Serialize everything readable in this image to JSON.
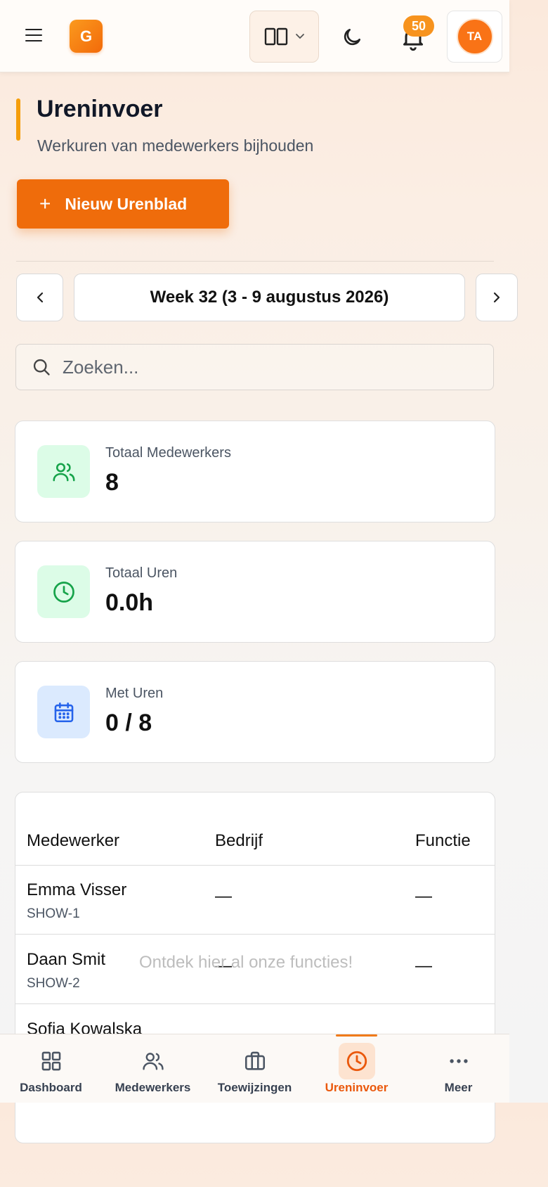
{
  "header": {
    "logo_letter": "G",
    "notification_count": "50",
    "avatar_initials": "TA",
    "icons": [
      "menu-icon",
      "layout-columns-icon",
      "chevron-down-icon",
      "moon-icon",
      "bell-icon"
    ]
  },
  "page": {
    "title": "Ureninvoer",
    "subtitle": "Werkuren van medewerkers bijhouden",
    "new_button": "Nieuw Urenblad",
    "accent_color": "#ef6c0b"
  },
  "week": {
    "label": "Week 32 (3 - 9 augustus 2026)"
  },
  "search": {
    "placeholder": "Zoeken..."
  },
  "stats": [
    {
      "label": "Totaal Medewerkers",
      "value": "8",
      "icon": "users-icon",
      "color": "#16a34a"
    },
    {
      "label": "Totaal Uren",
      "value": "0.0h",
      "icon": "clock-icon",
      "color": "#16a34a"
    },
    {
      "label": "Met Uren",
      "value": "0 / 8",
      "icon": "calendar-icon",
      "color": "#2563eb"
    }
  ],
  "table": {
    "headers": [
      "Medewerker",
      "Bedrijf",
      "Functie"
    ],
    "rows": [
      {
        "name": "Emma Visser",
        "code": "SHOW-1",
        "company": "—",
        "function": "—"
      },
      {
        "name": "Daan Smit",
        "code": "SHOW-2",
        "company": "—",
        "function": "—"
      },
      {
        "name": "Sofia Kowalska",
        "code": "",
        "company": "",
        "function": ""
      }
    ]
  },
  "tour_hint": "Ontdek hier al onze functies!",
  "bottom_nav": [
    {
      "label": "Dashboard",
      "icon": "dashboard-icon",
      "active": false
    },
    {
      "label": "Medewerkers",
      "icon": "users-icon",
      "active": false
    },
    {
      "label": "Toewijzingen",
      "icon": "briefcase-icon",
      "active": false
    },
    {
      "label": "Ureninvoer",
      "icon": "clock-icon",
      "active": true
    },
    {
      "label": "Meer",
      "icon": "more-icon",
      "active": false
    }
  ]
}
